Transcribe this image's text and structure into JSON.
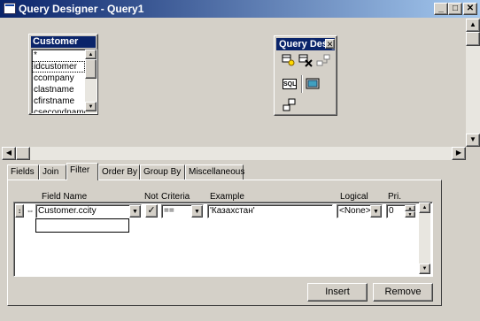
{
  "window": {
    "title": "Query Designer - Query1",
    "controls": {
      "minimize": "_",
      "maximize": "□",
      "close": "✕"
    }
  },
  "customer_table": {
    "title": "Customer",
    "fields": [
      "*",
      "idcustomer",
      "ccompany",
      "clastname",
      "cfirstname",
      "csecondname"
    ]
  },
  "toolbox": {
    "title": "Query Designer",
    "close": "✕",
    "tools": [
      "add-table-icon",
      "remove-table-icon",
      "relations-icon",
      "sql-icon",
      "view-results-icon",
      "join-icon"
    ],
    "sql_label": "SQL"
  },
  "tabs": [
    "Fields",
    "Join",
    "Filter",
    "Order By",
    "Group By",
    "Miscellaneous"
  ],
  "active_tab": "Filter",
  "filter": {
    "headers": {
      "field_name": "Field Name",
      "not": "Not",
      "criteria": "Criteria",
      "example": "Example",
      "logical": "Logical",
      "pri": "Pri."
    },
    "row": {
      "field_name": "Customer.ccity",
      "not_checked": true,
      "criteria": "==",
      "example": "'Казахстан'",
      "logical": "<None>",
      "priority": "0"
    }
  },
  "buttons": {
    "insert": "Insert",
    "remove": "Remove"
  }
}
